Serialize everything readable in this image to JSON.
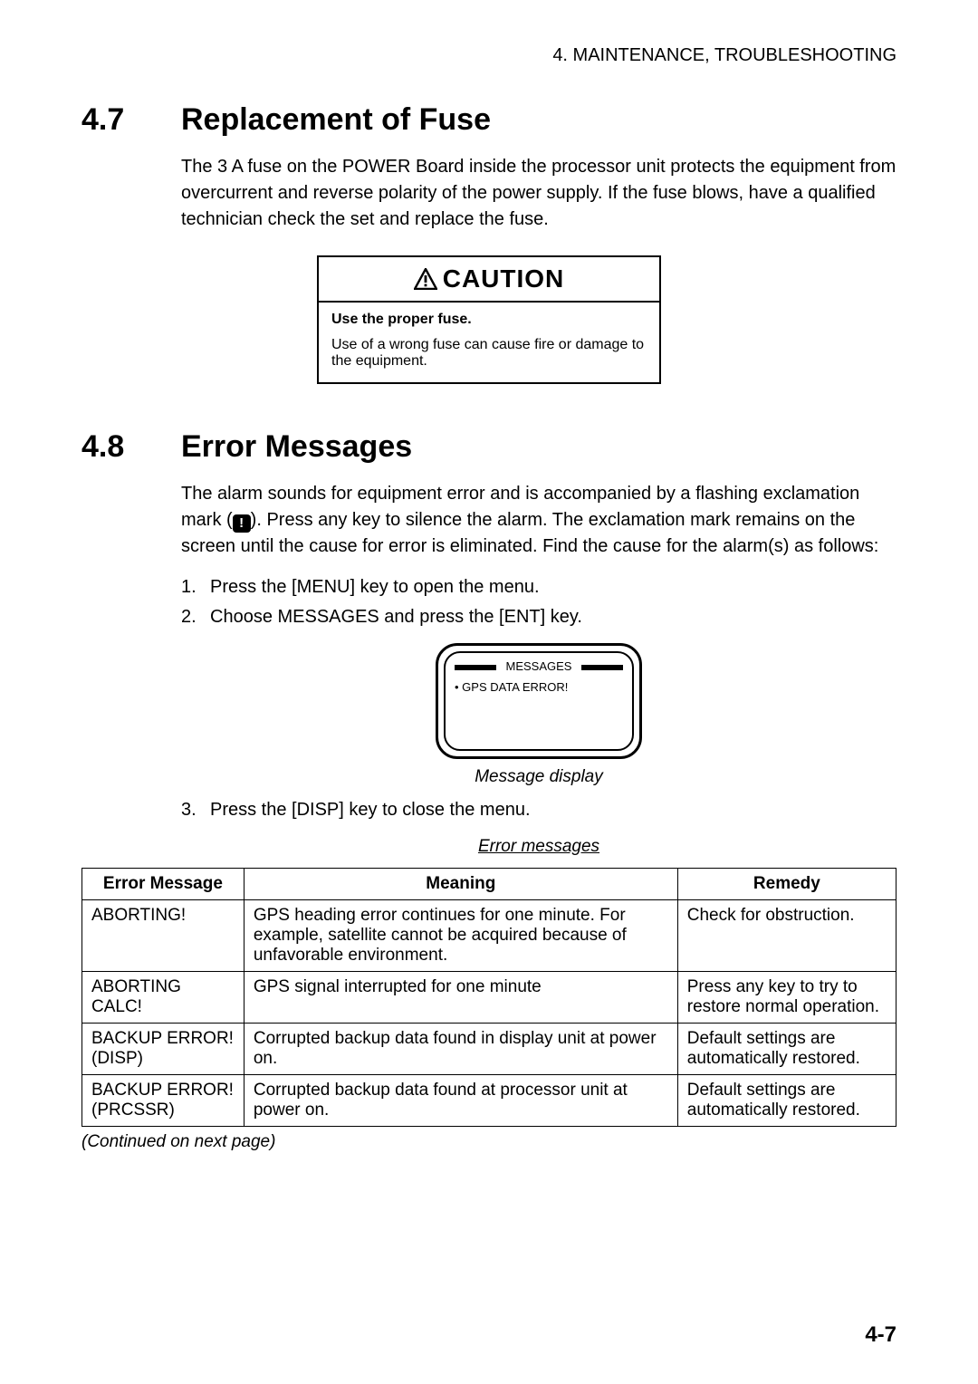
{
  "header": "4. MAINTENANCE, TROUBLESHOOTING",
  "section47": {
    "number": "4.7",
    "title": "Replacement of Fuse",
    "paragraph": "The 3 A fuse on the POWER Board inside the processor unit protects the equipment from overcurrent and reverse polarity of the power supply. If the fuse blows, have a qualified technician check the set and replace the fuse."
  },
  "caution": {
    "title": "CAUTION",
    "bold": "Use the proper fuse.",
    "body": "Use of a wrong fuse can cause fire or damage to the equipment."
  },
  "section48": {
    "number": "4.8",
    "title": "Error Messages",
    "paragraph_before": "The alarm sounds for equipment error and is accompanied by a flashing exclamation mark (",
    "paragraph_after": "). Press any key to silence the alarm. The exclamation mark remains on the screen until the cause for error is eliminated. Find the cause for the alarm(s) as follows:",
    "steps": [
      {
        "n": "1.",
        "t": "Press the [MENU] key to open the menu."
      },
      {
        "n": "2.",
        "t": "Choose MESSAGES and press the [ENT] key."
      }
    ],
    "display_header": "MESSAGES",
    "display_line": "• GPS DATA ERROR!",
    "display_caption": "Message display",
    "step3": {
      "n": "3.",
      "t": "Press the [DISP] key to close the menu."
    },
    "table_caption": "Error messages",
    "table_headers": {
      "c1": "Error Message",
      "c2": "Meaning",
      "c3": "Remedy"
    },
    "rows": [
      {
        "c1": "ABORTING!",
        "c2": "GPS heading error continues for one minute. For example, satellite cannot be acquired because of unfavorable environment.",
        "c3": "Check for obstruction."
      },
      {
        "c1": "ABORTING CALC!",
        "c2": "GPS signal interrupted for one minute",
        "c3": "Press any key to try to restore normal operation."
      },
      {
        "c1": "BACKUP ERROR!(DISP)",
        "c2": "Corrupted backup data found in display unit at power on.",
        "c3": "Default settings are automatically restored."
      },
      {
        "c1": "BACKUP ERROR!(PRCSSR)",
        "c2": "Corrupted backup data found at processor unit at power on.",
        "c3": "Default settings are automatically restored."
      }
    ],
    "continued": "(Continued on next page)"
  },
  "page_number": "4-7"
}
